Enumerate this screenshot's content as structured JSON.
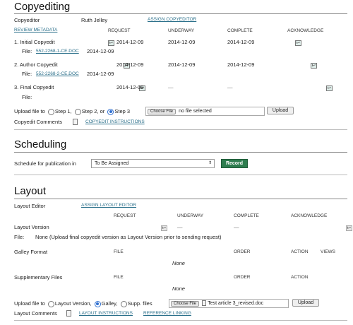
{
  "copyediting": {
    "title": "Copyediting",
    "copyeditor_label": "Copyeditor",
    "copyeditor_name": "Ruth Jelley",
    "assign_copyeditor": "ASSIGN COPYEDITOR",
    "review_metadata": "REVIEW METADATA",
    "cols": {
      "request": "REQUEST",
      "underway": "UNDERWAY",
      "complete": "COMPLETE",
      "acknowledge": "ACKNOWLEDGE"
    },
    "rows": [
      {
        "label": "1. Initial Copyedit",
        "request": "2014-12-09",
        "underway": "2014-12-09",
        "complete": "2014-12-09",
        "file_label": "File:",
        "file_name": "552-2268-1-CE.DOC",
        "file_date": "2014-12-09"
      },
      {
        "label": "2. Author Copyedit",
        "request": "2014-12-09",
        "underway": "2014-12-09",
        "complete": "2014-12-09",
        "file_label": "File:",
        "file_name": "552-2268-2-CE.DOC",
        "file_date": "2014-12-09"
      },
      {
        "label": "3. Final Copyedit",
        "request": "2014-12-09",
        "underway": "—",
        "complete": "—",
        "file_label": "File:",
        "file_name": "",
        "file_date": ""
      }
    ],
    "upload_label": "Upload file to",
    "step1": "Step 1,",
    "step2": "Step 2, or",
    "step3": "Step 3",
    "choose_file": "Choose File",
    "no_file": "no file selected",
    "upload_button": "Upload",
    "comments_label": "Copyedit Comments",
    "instructions_link": "COPYEDIT INSTRUCTIONS"
  },
  "scheduling": {
    "title": "Scheduling",
    "label": "Schedule for publication in",
    "selected": "To Be Assigned",
    "record_button": "Record"
  },
  "layout": {
    "title": "Layout",
    "editor_label": "Layout Editor",
    "assign_link": "ASSIGN LAYOUT EDITOR",
    "cols": {
      "request": "REQUEST",
      "underway": "UNDERWAY",
      "complete": "COMPLETE",
      "acknowledge": "ACKNOWLEDGE"
    },
    "version_label": "Layout Version",
    "version_underway": "—",
    "version_complete": "—",
    "file_label": "File:",
    "file_note": "None (Upload final copyedit version as Layout Version prior to sending request)",
    "galley": {
      "label": "Galley Format",
      "file": "FILE",
      "order": "ORDER",
      "action": "ACTION",
      "views": "VIEWS",
      "empty": "None"
    },
    "supp": {
      "label": "Supplementary Files",
      "file": "FILE",
      "order": "ORDER",
      "action": "ACTION",
      "empty": "None"
    },
    "upload_label": "Upload file to",
    "opt_layout": "Layout Version,",
    "opt_galley": "Galley,",
    "opt_supp": "Supp. files",
    "choose_file": "Choose File",
    "file_name": "Test article 3_revised.doc",
    "upload_button": "Upload",
    "comments_label": "Layout Comments",
    "instructions_link": "LAYOUT INSTRUCTIONS",
    "reference_link": "REFERENCE LINKING"
  }
}
